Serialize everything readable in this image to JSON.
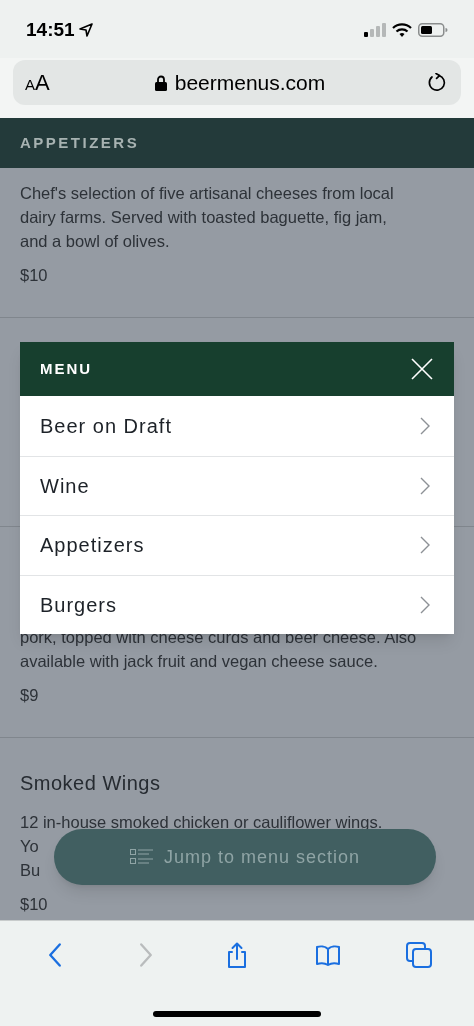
{
  "status_bar": {
    "time": "14:51"
  },
  "url_bar": {
    "text_size_button": "AA",
    "domain": "beermenus.com"
  },
  "section_header": "APPETIZERS",
  "items": [
    {
      "description_lines": [
        "Chef's selection of five artisanal cheeses from local",
        "dairy farms. Served with toasted baguette, fig jam,",
        "and a bowl of olives."
      ],
      "price": "$10"
    },
    {
      "description_lines": [
        "pork, topped with cheese curds and beer cheese. Also",
        "available with jack fruit and vegan cheese sauce."
      ],
      "price": "$9"
    },
    {
      "title": "Smoked Wings",
      "description_lines": [
        "12 in-house smoked chicken or cauliflower wings.",
        "Yo",
        "Bu"
      ],
      "price": "$10"
    }
  ],
  "menu": {
    "title": "MENU",
    "items": [
      {
        "label": "Beer on Draft"
      },
      {
        "label": "Wine"
      },
      {
        "label": "Appetizers"
      },
      {
        "label": "Burgers"
      }
    ]
  },
  "jump_button": "Jump to menu section",
  "toolbar": {
    "buttons": [
      {
        "kind": "back",
        "disabled": false
      },
      {
        "kind": "forward",
        "disabled": true
      },
      {
        "kind": "share",
        "disabled": false
      },
      {
        "kind": "bookmarks",
        "disabled": false
      },
      {
        "kind": "tabs",
        "disabled": false
      }
    ]
  }
}
